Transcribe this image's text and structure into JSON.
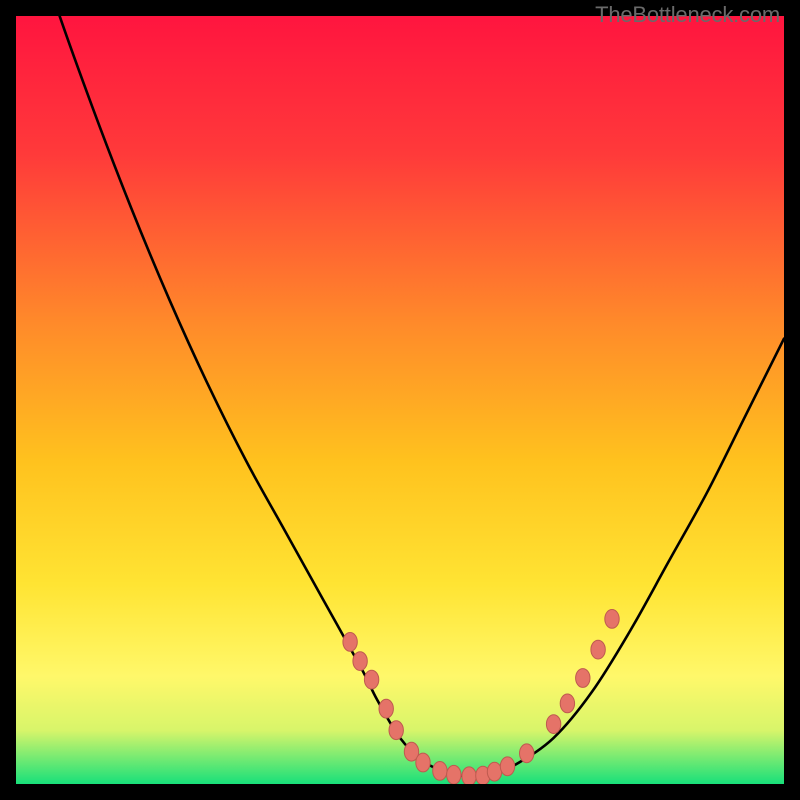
{
  "watermark": "TheBottleneck.com",
  "colors": {
    "frame": "#000000",
    "gradient_top": "#ff153f",
    "gradient_mid_upper": "#ff7b2f",
    "gradient_mid": "#ffd21e",
    "gradient_lower": "#fff24a",
    "gradient_bottom": "#18e07a",
    "curve": "#000000",
    "dot_fill": "#e57368",
    "dot_stroke": "#be5a4f"
  },
  "chart_data": {
    "type": "line",
    "title": "",
    "xlabel": "",
    "ylabel": "",
    "xlim": [
      0,
      100
    ],
    "ylim": [
      0,
      100
    ],
    "grid": false,
    "legend": false,
    "series": [
      {
        "name": "bottleneck-curve",
        "x": [
          0,
          5,
          10,
          15,
          20,
          25,
          30,
          35,
          40,
          45,
          47,
          50,
          53,
          56,
          59,
          62,
          65,
          70,
          75,
          80,
          85,
          90,
          95,
          100
        ],
        "y": [
          118,
          102,
          88,
          75,
          63,
          52,
          42,
          33,
          24,
          15,
          11,
          6,
          3,
          1.5,
          1,
          1.2,
          2.5,
          6,
          12,
          20,
          29,
          38,
          48,
          58
        ]
      }
    ],
    "highlight_dots": {
      "name": "data-dots",
      "points": [
        {
          "x": 43.5,
          "y": 18.5
        },
        {
          "x": 44.8,
          "y": 16.0
        },
        {
          "x": 46.3,
          "y": 13.6
        },
        {
          "x": 48.2,
          "y": 9.8
        },
        {
          "x": 49.5,
          "y": 7.0
        },
        {
          "x": 51.5,
          "y": 4.2
        },
        {
          "x": 53.0,
          "y": 2.8
        },
        {
          "x": 55.2,
          "y": 1.7
        },
        {
          "x": 57.0,
          "y": 1.2
        },
        {
          "x": 59.0,
          "y": 1.0
        },
        {
          "x": 60.8,
          "y": 1.1
        },
        {
          "x": 62.3,
          "y": 1.6
        },
        {
          "x": 64.0,
          "y": 2.3
        },
        {
          "x": 66.5,
          "y": 4.0
        },
        {
          "x": 70.0,
          "y": 7.8
        },
        {
          "x": 71.8,
          "y": 10.5
        },
        {
          "x": 73.8,
          "y": 13.8
        },
        {
          "x": 75.8,
          "y": 17.5
        },
        {
          "x": 77.6,
          "y": 21.5
        }
      ]
    }
  }
}
